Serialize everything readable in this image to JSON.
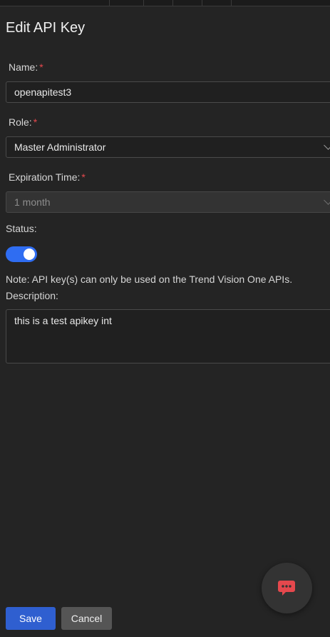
{
  "dialog": {
    "title": "Edit API Key"
  },
  "form": {
    "name": {
      "label": "Name:",
      "required_mark": "*",
      "value": "openapitest3"
    },
    "role": {
      "label": "Role:",
      "required_mark": "*",
      "value": "Master Administrator"
    },
    "expiration": {
      "label": "Expiration Time:",
      "required_mark": "*",
      "value": "1 month",
      "disabled": true
    },
    "status": {
      "label": "Status:",
      "enabled": true
    },
    "note": "Note: API key(s) can only be used on the Trend Vision One APIs.",
    "description": {
      "label": "Description:",
      "value": "this is a test apikey int"
    }
  },
  "actions": {
    "save_label": "Save",
    "cancel_label": "Cancel"
  },
  "chat": {
    "icon": "chat-bubble-icon"
  },
  "colors": {
    "background": "#242424",
    "accent": "#2f6df2",
    "save_button": "#2f5fd0",
    "cancel_button": "#555555",
    "required": "#e5484d",
    "chat_icon": "#e5484d"
  }
}
